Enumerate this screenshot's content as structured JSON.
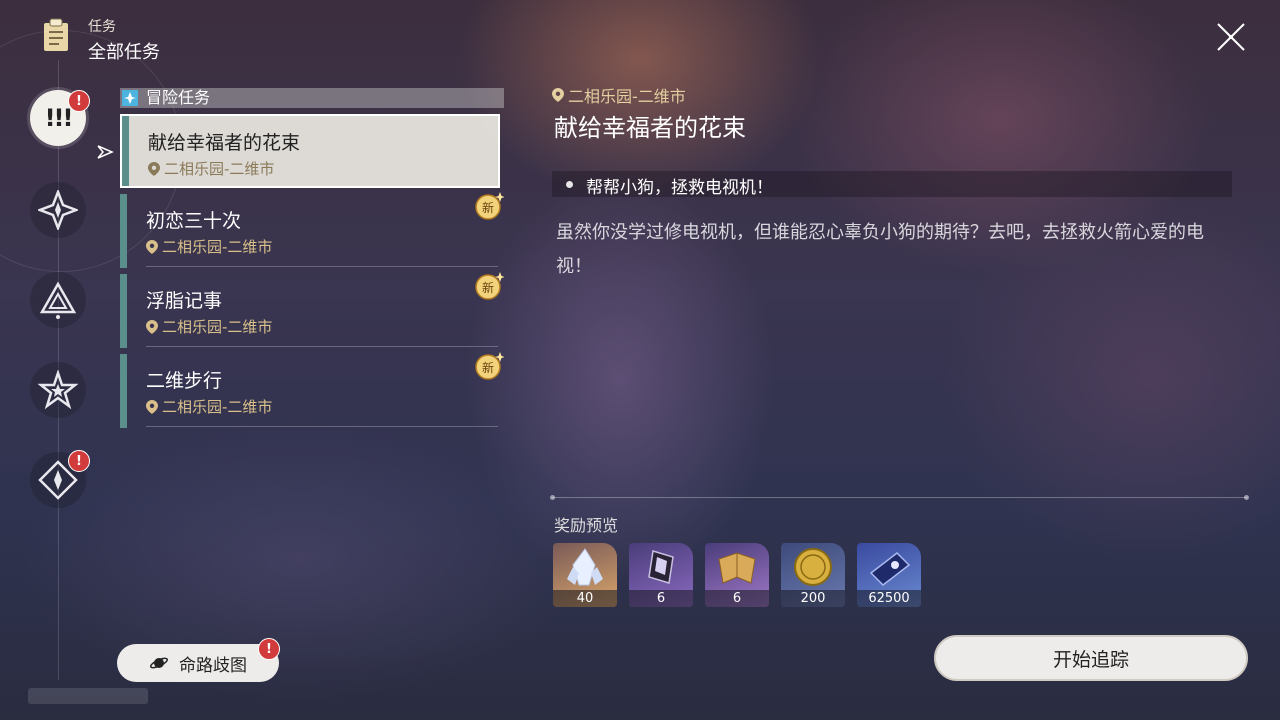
{
  "header": {
    "small_label": "任务",
    "title": "全部任务"
  },
  "rail": {
    "active_icon_text": "!!!",
    "badge_text": "!"
  },
  "section": {
    "label": "冒险任务"
  },
  "quests": [
    {
      "name": "献给幸福者的花束",
      "location": "二相乐园-二维市",
      "is_new": false,
      "selected": true
    },
    {
      "name": "初恋三十次",
      "location": "二相乐园-二维市",
      "is_new": true,
      "new_label": "新"
    },
    {
      "name": "浮脂记事",
      "location": "二相乐园-二维市",
      "is_new": true,
      "new_label": "新"
    },
    {
      "name": "二维步行",
      "location": "二相乐园-二维市",
      "is_new": true,
      "new_label": "新"
    }
  ],
  "detail": {
    "location": "二相乐园-二维市",
    "title": "献给幸福者的花束",
    "objective": "帮帮小狗，拯救电视机！",
    "description": "虽然你没学过修电视机，但谁能忍心辜负小狗的期待？去吧，去拯救火箭心爱的电视！"
  },
  "rewards": {
    "title": "奖励预览",
    "items": [
      {
        "icon": "crystal-icon",
        "count": "40"
      },
      {
        "icon": "gem-shard-icon",
        "count": "6"
      },
      {
        "icon": "tome-icon",
        "count": "6"
      },
      {
        "icon": "credit-coin-icon",
        "count": "200"
      },
      {
        "icon": "exp-card-icon",
        "count": "62500"
      }
    ]
  },
  "buttons": {
    "track": "开始追踪",
    "path_map": "命路歧图"
  },
  "colors": {
    "stripe": "#5b8f8c",
    "location_gold": "#d9c08a",
    "badge_red": "#d23b3b",
    "new_badge": "#e0a830"
  }
}
